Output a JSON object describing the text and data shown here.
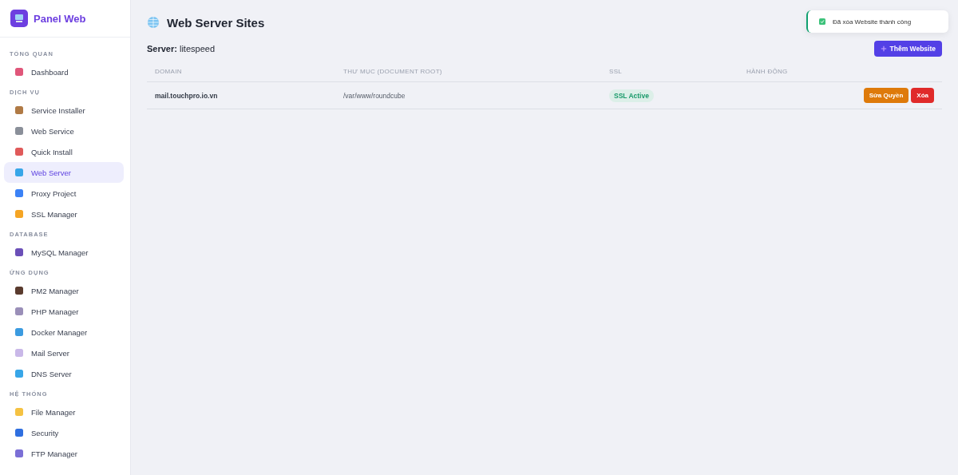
{
  "brand": "Panel Web",
  "sidebar": [
    {
      "heading": "TỔNG QUAN",
      "items": [
        {
          "label": "Dashboard",
          "selected": false
        }
      ]
    },
    {
      "heading": "DỊCH VỤ",
      "items": [
        {
          "label": "Service Installer",
          "selected": false
        },
        {
          "label": "Web Service",
          "selected": false
        },
        {
          "label": "Quick Install",
          "selected": false
        },
        {
          "label": "Web Server",
          "selected": true
        },
        {
          "label": "Proxy Project",
          "selected": false
        },
        {
          "label": "SSL Manager",
          "selected": false
        }
      ]
    },
    {
      "heading": "DATABASE",
      "items": [
        {
          "label": "MySQL Manager",
          "selected": false
        }
      ]
    },
    {
      "heading": "ỨNG DỤNG",
      "items": [
        {
          "label": "PM2 Manager",
          "selected": false
        },
        {
          "label": "PHP Manager",
          "selected": false
        },
        {
          "label": "Docker Manager",
          "selected": false
        },
        {
          "label": "Mail Server",
          "selected": false
        },
        {
          "label": "DNS Server",
          "selected": false
        }
      ]
    },
    {
      "heading": "HỆ THỐNG",
      "items": [
        {
          "label": "File Manager",
          "selected": false
        },
        {
          "label": "Security",
          "selected": false
        },
        {
          "label": "FTP Manager",
          "selected": false
        }
      ]
    }
  ],
  "page_title": "Web Server Sites",
  "server_label": "Server:",
  "server_value": "litespeed",
  "add_button": "Thêm Website",
  "table": {
    "columns": [
      "DOMAIN",
      "THƯ MỤC (DOCUMENT ROOT)",
      "SSL",
      "HÀNH ĐỘNG"
    ],
    "rows": [
      {
        "domain": "mail.touchpro.io.vn",
        "root": "/var/www/roundcube",
        "ssl": "SSL Active",
        "actions": [
          "Sửa Quyền",
          "Xóa"
        ]
      }
    ]
  },
  "toast": {
    "message": "Đã xóa Website thành công"
  }
}
